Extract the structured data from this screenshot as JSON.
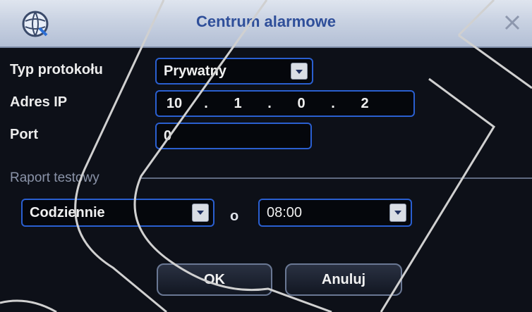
{
  "window": {
    "title": "Centrum alarmowe",
    "app_icon": "globe-wrench-icon",
    "close_icon": "close-icon"
  },
  "form": {
    "protocol": {
      "label": "Typ protokołu",
      "value": "Prywatny"
    },
    "ip": {
      "label": "Adres IP",
      "octets": [
        "10",
        "1",
        "0",
        "2"
      ]
    },
    "port": {
      "label": "Port",
      "value": "0"
    },
    "report": {
      "section_label": "Raport testowy",
      "frequency": "Codziennie",
      "at_label": "o",
      "time": "08:00"
    }
  },
  "buttons": {
    "ok": "OK",
    "cancel": "Anuluj"
  },
  "colors": {
    "field_border": "#2a5fd0",
    "title_text": "#2f4f9a",
    "background": "#0d1018"
  }
}
